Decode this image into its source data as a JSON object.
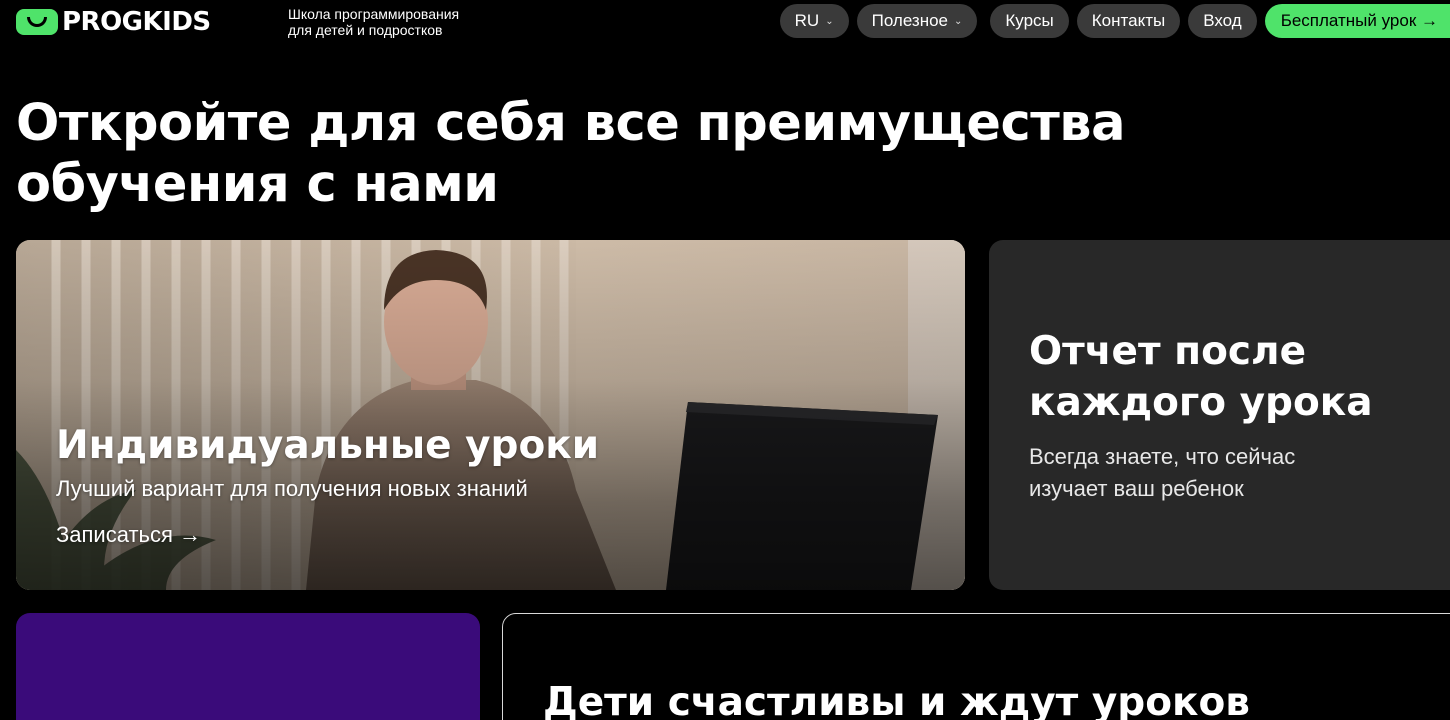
{
  "header": {
    "logo_text": "PROGKIDS",
    "tagline_line1": "Школа программирования",
    "tagline_line2": "для детей и подростков",
    "nav": {
      "language": "RU",
      "useful": "Полезное",
      "courses": "Курсы",
      "contacts": "Контакты",
      "login": "Вход",
      "free_lesson": "Бесплатный урок →"
    }
  },
  "hero": {
    "title_line1": "Откройте для себя все преимущества",
    "title_line2": "обучения с нами"
  },
  "cards": {
    "individual": {
      "title": "Индивидуальные уроки",
      "subtitle": "Лучший вариант для получения новых знаний",
      "link": "Записаться →"
    },
    "report": {
      "title_line1": "Отчет после",
      "title_line2": "каждого урока",
      "subtitle_line1": "Всегда знаете, что сейчас",
      "subtitle_line2": "изучает ваш ребенок"
    },
    "happy": {
      "title": "Дети счастливы и ждут уроков"
    }
  },
  "colors": {
    "background": "#000000",
    "accent_green": "#4fe36a",
    "pill_gray": "#3a3a3a",
    "card_gray": "#282828",
    "card_purple": "#3a0b7a"
  },
  "icons": {
    "logo": "smile-logo-icon",
    "dropdown": "chevron-down-icon",
    "arrow": "arrow-right-icon"
  }
}
